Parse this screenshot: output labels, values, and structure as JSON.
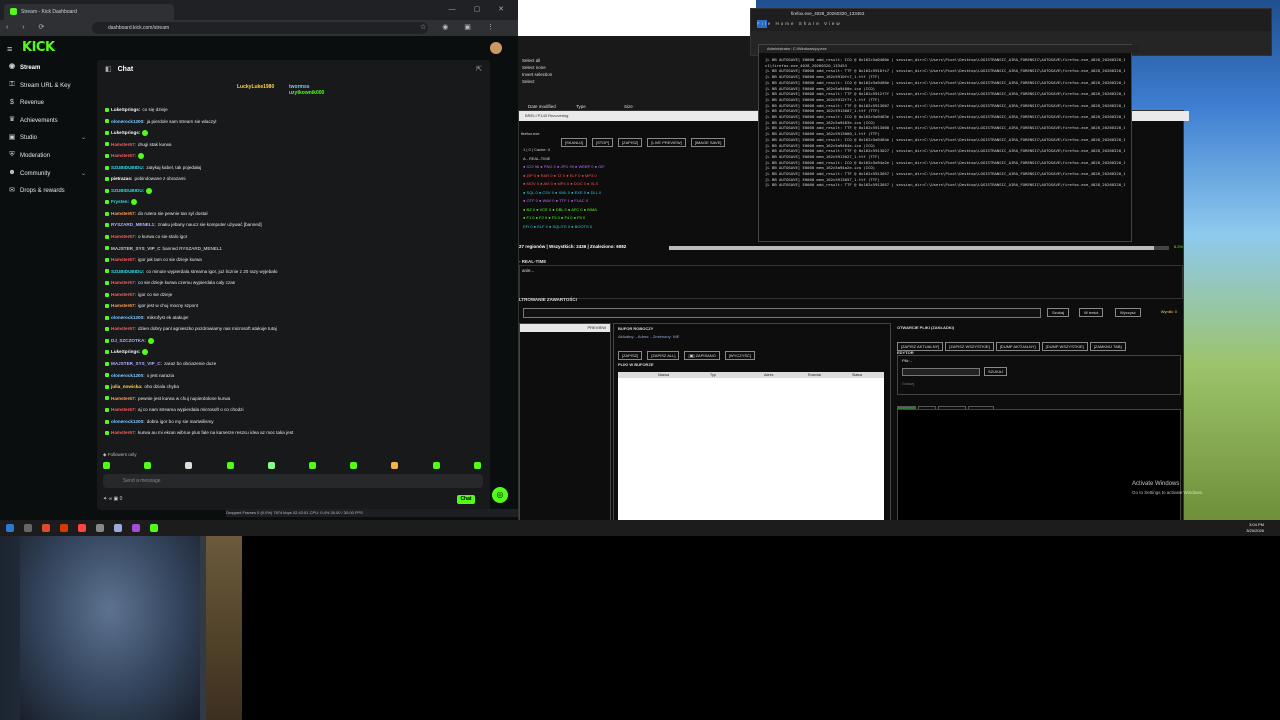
{
  "browser": {
    "tab_title": "Stream - Kick Dashboard",
    "url": "dashboard.kick.com/stream"
  },
  "kick": {
    "logo": "KICK",
    "sidebar": [
      {
        "label": "Stream",
        "icon": "broadcast-icon",
        "active": true
      },
      {
        "label": "Stream URL & Key",
        "icon": "key-icon"
      },
      {
        "label": "Revenue",
        "icon": "dollar-icon"
      },
      {
        "label": "Achievements",
        "icon": "trophy-icon"
      },
      {
        "label": "Studio",
        "icon": "studio-icon",
        "expandable": true
      },
      {
        "label": "Moderation",
        "icon": "shield-icon"
      },
      {
        "label": "Community",
        "icon": "community-icon",
        "expandable": true
      },
      {
        "label": "Drops & rewards",
        "icon": "gift-icon"
      }
    ]
  },
  "chat": {
    "title": "Chat",
    "pinned_users": [
      "LuckyLuke1980",
      "twormss",
      "uzytkownik000"
    ],
    "messages": [
      {
        "user": "LukeSprings:",
        "text": "co się dzieje",
        "color": "#f5f5f5"
      },
      {
        "user": "olonerock1200:",
        "text": "ja pierdole sam stream sie wlaczyl",
        "color": "#7ec8ff"
      },
      {
        "user": "LukeSprings:",
        "text": "",
        "color": "#f5f5f5"
      },
      {
        "user": "Hamster67:",
        "text": "drugi stak kurwa",
        "color": "#ff5b5b"
      },
      {
        "user": "Hamster67:",
        "text": "",
        "color": "#ff5b5b"
      },
      {
        "user": "SZUBIDUBIDU:",
        "text": "zatykaj kabel, tak pojedałaj",
        "color": "#2cd9e8"
      },
      {
        "user": "pietrazas:",
        "text": "pobindowane z obrazami",
        "color": "#ffffff"
      },
      {
        "user": "SZUBIDUBIDU:",
        "text": "",
        "color": "#2cd9e8"
      },
      {
        "user": "Frysten:",
        "text": "",
        "color": "#2cd9e8"
      },
      {
        "user": "Hamster67:",
        "text": "do rutera sie pewnie tan syl dostal",
        "color": "#ff9e57"
      },
      {
        "user": "RYSZARD_MENEL1:",
        "text": "znaku jebany naucz sie komputer używać [banned]",
        "color": "#b0b0ff"
      },
      {
        "user": "Hamster67:",
        "text": "o kurwa co sie stalo igor",
        "color": "#ff5b5b"
      },
      {
        "user": "MAJSTER_SYS_VIP_C",
        "text": "banned RYSZARD_MENEL1",
        "color": "#c7c7c7"
      },
      {
        "user": "Hamster67:",
        "text": "igor jak tam co sie dzieje kurwa",
        "color": "#ff5b5b"
      },
      {
        "user": "SZUBIDUBIDU:",
        "text": "co minute wypierdala streama igor, już licznie z 20 razy wyjebało",
        "color": "#2cd9e8"
      },
      {
        "user": "Hamster67:",
        "text": "co sie dzieje kurwa czemu wypierdala caly czas",
        "color": "#ff5b5b"
      },
      {
        "user": "Hamster67:",
        "text": "igor co sie dzieje",
        "color": "#ff5b5b"
      },
      {
        "user": "Hamster67:",
        "text": "igor jest w chuj mocny szpont",
        "color": "#ff9e57"
      },
      {
        "user": "olonerock1200:",
        "text": "mikrofyst ek atakuje!",
        "color": "#7ec8ff"
      },
      {
        "user": "Hamster67:",
        "text": "dzien dobry panl agnieszko pozdrowiamy nas microsoft atakuje tutaj",
        "color": "#ff5b5b"
      },
      {
        "user": "DJ_SZCZOTKA:",
        "text": "",
        "color": "#b0b0ff"
      },
      {
        "user": "LukeSprings:",
        "text": "",
        "color": "#f5f5f5"
      },
      {
        "user": "MAJSTER_SYS_VIP_C:",
        "text": "zaraz bo obciazenie duze",
        "color": "#b0b0ff"
      },
      {
        "user": "olonerock1200:",
        "text": "o jest narazia",
        "color": "#7ec8ff"
      },
      {
        "user": "julia_nowicka:",
        "text": "oho dziala chyba",
        "color": "#ffd24a"
      },
      {
        "user": "Hamster67:",
        "text": "pewnie jest kurwa w chuj napierdolone kurwa",
        "color": "#ff9e57"
      },
      {
        "user": "Hamster67:",
        "text": "aj co nam streama wypierdala microsoft o co chodzi",
        "color": "#ff5b5b"
      },
      {
        "user": "olonerock1200:",
        "text": "dobra igor bo my sie martwilismy",
        "color": "#7ec8ff"
      },
      {
        "user": "Hamster67:",
        "text": "kurwa au mi ekran wibrue plus fale na kamerze reszcu idea az moc taka jest",
        "color": "#ff5b5b"
      }
    ],
    "followers_label": "Followers only",
    "input_placeholder": "Send a message",
    "bottom_count": "0",
    "chat_button": "Chat"
  },
  "obs_status": "Dropped Frames 0 (0.0%)   7874 kbps   02:42:51   CPU: 0.4%   30.00 / 30.00 FPS",
  "desktop": {
    "icon_label": "LOGIS2RADIO",
    "explorer_title": "firefox.exe_4028_20260320_133453",
    "explorer_tabs": "File  Home  Share  View",
    "explorer_small_rows": [
      "Select all",
      "Select none",
      "Invert selection",
      "Select"
    ],
    "explorer_cols": [
      "Date modified",
      "Type",
      "Size"
    ],
    "console_title": "Administrator: C:\\Windows\\py.exe",
    "console_lines": [
      "[L BB AUTOSAVE] E0000 add_result: ICO @ 0x162c5a0480e | session_dir=C:\\Users\\Pixel\\Desktop\\LOGISTRANSIC_AIRA_FORENSIC\\AUTOSAVE\\firefox.exe_4028_20260320_133453\\mem_162",
      "c1\\firefox.exe_4028_20260320_133453",
      "[L BB AUTOSAVE] E0000 add_result: TTF @ 0x162c5910fc7 | session_dir=C:\\Users\\Pixel\\Desktop\\LOGISTRANSIC_AIRA_FORENSIC\\AUTOSAVE\\firefox.exe_4028_20260320_133453\\mem_1",
      "[L BB AUTOSAVE] E0000 mem_162c5910fc7_1.ttf (TTF)",
      "[L BB AUTOSAVE] E0000 add_result: ICO @ 0x162c5a9480e | session_dir=C:\\Users\\Pixel\\Desktop\\LOGISTRANSIC_AIRA_FORENSIC\\AUTOSAVE\\firefox.exe_4028_20260320_133453",
      "[L BB AUTOSAVE] E0000 mem_162c5a9480e.ico (ICO)",
      "[L BB AUTOSAVE] E0000 add_result: TTF @ 0x162c5912f7f | session_dir=C:\\Users\\Pixel\\Desktop\\LOGISTRANSIC_AIRA_FORENSIC\\AUTOSAVE\\firefox.exe_4028_20260320_133453\\mem_1",
      "[L BB AUTOSAVE] E0000 mem_162c5912f7f_1.ttf (TTF)",
      "[L BB AUTOSAVE] E0000 add_result: TTF @ 0x162c5913007 | session_dir=C:\\Users\\Pixel\\Desktop\\LOGISTRANSIC_AIRA_FORENSIC\\AUTOSAVE\\firefox.exe_4028_20260320_133453",
      "[L BB AUTOSAVE] E0000 mem_162c5913007_1.ttf (TTF)",
      "[L BB AUTOSAVE] E0000 add_result: ICO @ 0x162c5a9483e | session_dir=C:\\Users\\Pixel\\Desktop\\LOGISTRANSIC_AIRA_FORENSIC\\AUTOSAVE\\firefox.exe_4028_20260320_133453\\mem_1",
      "[L BB AUTOSAVE] E0000 mem_162c5a9483e.ico (ICO)",
      "[L BB AUTOSAVE] E0000 add_result: TTF @ 0x162c5913000 | session_dir=C:\\Users\\Pixel\\Desktop\\LOGISTRANSIC_AIRA_FORENSIC\\AUTOSAVE\\firefox.exe_4028_20260320_133453",
      "[L BB AUTOSAVE] E0000 mem_162c5913000_1.ttf (TTF)",
      "[L BB AUTOSAVE] E0000 add_result: ICO @ 0x162c5a9484e | session_dir=C:\\Users\\Pixel\\Desktop\\LOGISTRANSIC_AIRA_FORENSIC\\AUTOSAVE\\firefox.exe_4028_20260320_133453",
      "[L BB AUTOSAVE] E0000 mem_162c5a9484e.ico (ICO)",
      "[L BB AUTOSAVE] E0000 add_result: TTF @ 0x162c5913027 | session_dir=C:\\Users\\Pixel\\Desktop\\LOGISTRANSIC_AIRA_FORENSIC\\AUTOSAVE\\firefox.exe_4028_20260320_133453\\mem_1",
      "[L BB AUTOSAVE] E0000 mem_162c5913027_1.ttf (TTF)",
      "[L BB AUTOSAVE] E0000 add_result: ICO @ 0x162c5a94a2e | session_dir=C:\\Users\\Pixel\\Desktop\\LOGISTRANSIC_AIRA_FORENSIC\\AUTOSAVE\\firefox.exe_4028_20260320_133453",
      "[L BB AUTOSAVE] E0000 mem_162c5a94a2e.ico (ICO)",
      "[L BB AUTOSAVE] E0000 add_result: TTF @ 0x162c5913057 | session_dir=C:\\Users\\Pixel\\Desktop\\LOGISTRANSIC_AIRA_FORENSIC\\AUTOSAVE\\firefox.exe_4028_20260320_133453\\mem_1",
      "[L BB AUTOSAVE] E0000 mem_162c5913057_1.ttf (TTF)",
      "[L BB AUTOSAVE] E0000 add_result: TTF @ 0x162c5913057 | session_dir=C:\\Users\\Pixel\\Desktop\\LOGISTRANSIC_AIRA_FORENSIC\\AUTOSAVE\\firefox.exe_4028_20260320_133453"
    ],
    "forensic": {
      "header": "BRELI P143 Recovering",
      "buttons": [
        "[SKANUJ]",
        "[STOP]",
        "[ZAPISZ]",
        "[LIVE PREVIEW]",
        "[IMAGE SAVE]"
      ],
      "process_label": "firefox.exe",
      "list": [
        {
          "t": "1 | 0 | Cache: 0",
          "c": ""
        },
        {
          "t": "A - REAL-TIME",
          "c": ""
        },
        {
          "t": "●  ICO 96   ● PNG 0   ● JPG 99   ● WEBP 0   ● GIF",
          "c": "c2"
        },
        {
          "t": "●  ZIP 0    ● RAR 0   ● 7Z 0     ● ELF 0   ● MP3 0",
          "c": "c1"
        },
        {
          "t": "●  MOV 0    ● AVI 0   ● MP4 0    ● DOC 0   ● XLS",
          "c": "c1"
        },
        {
          "t": "●  SQL 0    ● CSV 0   ● XML 0    ● EXE 0   ● DLL 0",
          "c": "c4"
        },
        {
          "t": "●  OTF 0    ● WAV 0   ● TTF 1    ● FLAC 0",
          "c": "c2"
        },
        {
          "t": "●  BZ 0     ● VCE 0   ● DBL 0    ● AFC 0   ● BIMA",
          "c": "c3"
        },
        {
          "t": "●  F1 0     ● F2 0    ● F3 0     ● F4 0    ● F5 0",
          "c": "c3"
        },
        {
          "t": "EFI 0   ● ELF 0   ● SQLITE 0   ● BOOTS 0",
          "c": "c4"
        }
      ],
      "stat": "27 regionów | Wszystkich: 2436 | Znaleziono: 6082",
      "progress": 0.97,
      "progress_label": "8.2%",
      "realtime_label": "- REAL-TIME",
      "realtime_text": "anie...",
      "filter_label": "LTROWANIE ZAWARTOŚCI",
      "search_buttons": [
        "Szukaj",
        "W treści",
        "Wyczyść"
      ],
      "found_label": "Wyniki: 0",
      "left_header": "PREVIEW",
      "buffer_label": "BUFOR ROBOCZY",
      "buffer_meta": "Aktualny: -    Adres: -    Zmienony: NIE",
      "buffer_buttons": [
        "[ZAPISZ]",
        "[ZAPISZ ALL]",
        "[▣] ZAPISANO",
        "[WYCZYŚĆ]"
      ],
      "files_label": "PLIKI W BUFORZE",
      "table_headers": [
        "Nazwa",
        "Typ",
        "Adres",
        "Rozmiar",
        "Status"
      ],
      "open_label": "OTWARCIE PLIKI (ZAKŁADKI)",
      "open_buttons": [
        "[ZAPISZ AKTUALNY]",
        "[ZAPISZ WSZYSTKIE]",
        "[DUMP AKTUALNY]",
        "[DUMP WSZYSTKIE]",
        "[ZAMKNIJ TAB]"
      ],
      "editor_label": "EDYTOR",
      "editor_field": "Plik: -",
      "editor_button": "SZUKAJ",
      "editor_hint": "Gotowy",
      "view_tabs": [
        "KOD",
        "HEX",
        "PREVIEW",
        "AI CHAT"
      ]
    },
    "watermark_title": "Activate Windows",
    "watermark_sub": "Go to Settings to activate Windows.",
    "clock_time": "3:04 PM",
    "clock_date": "3/20/2026"
  }
}
